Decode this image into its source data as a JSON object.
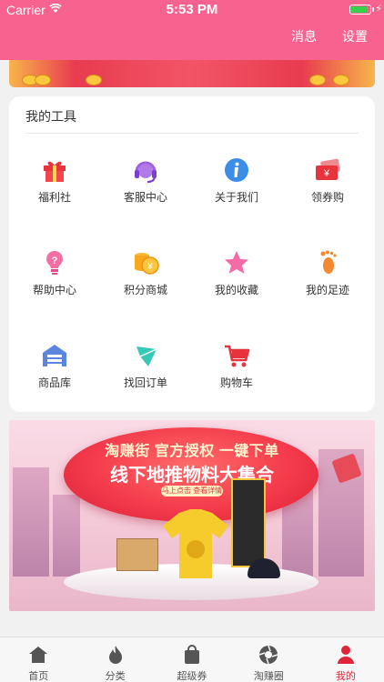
{
  "status_bar": {
    "carrier": "Carrier",
    "time": "5:53 PM",
    "battery_level": 0.9
  },
  "nav": {
    "messages_label": "消息",
    "settings_label": "设置"
  },
  "tools": {
    "title": "我的工具",
    "items": [
      {
        "label": "福利社",
        "icon": "gift-icon"
      },
      {
        "label": "客服中心",
        "icon": "headset-icon"
      },
      {
        "label": "关于我们",
        "icon": "info-icon"
      },
      {
        "label": "领券购",
        "icon": "coupon-icon"
      },
      {
        "label": "帮助中心",
        "icon": "help-icon"
      },
      {
        "label": "积分商城",
        "icon": "points-coins-icon"
      },
      {
        "label": "我的收藏",
        "icon": "star-icon"
      },
      {
        "label": "我的足迹",
        "icon": "footprint-icon"
      },
      {
        "label": "商品库",
        "icon": "warehouse-icon"
      },
      {
        "label": "找回订单",
        "icon": "recover-order-icon"
      },
      {
        "label": "购物车",
        "icon": "cart-icon"
      }
    ]
  },
  "promo": {
    "line1": "淘赚街 官方授权 一键下单",
    "line2": "线下地推物料大集合",
    "sub": "马上点击 查看详情"
  },
  "tabbar": {
    "items": [
      {
        "label": "首页",
        "icon": "home-icon",
        "active": false
      },
      {
        "label": "分类",
        "icon": "flame-icon",
        "active": false
      },
      {
        "label": "超级券",
        "icon": "bag-icon",
        "active": false
      },
      {
        "label": "淘赚圈",
        "icon": "aperture-icon",
        "active": false
      },
      {
        "label": "我的",
        "icon": "user-icon",
        "active": true
      }
    ]
  },
  "colors": {
    "brand_pink": "#f7628f",
    "active_red": "#e0253a"
  }
}
